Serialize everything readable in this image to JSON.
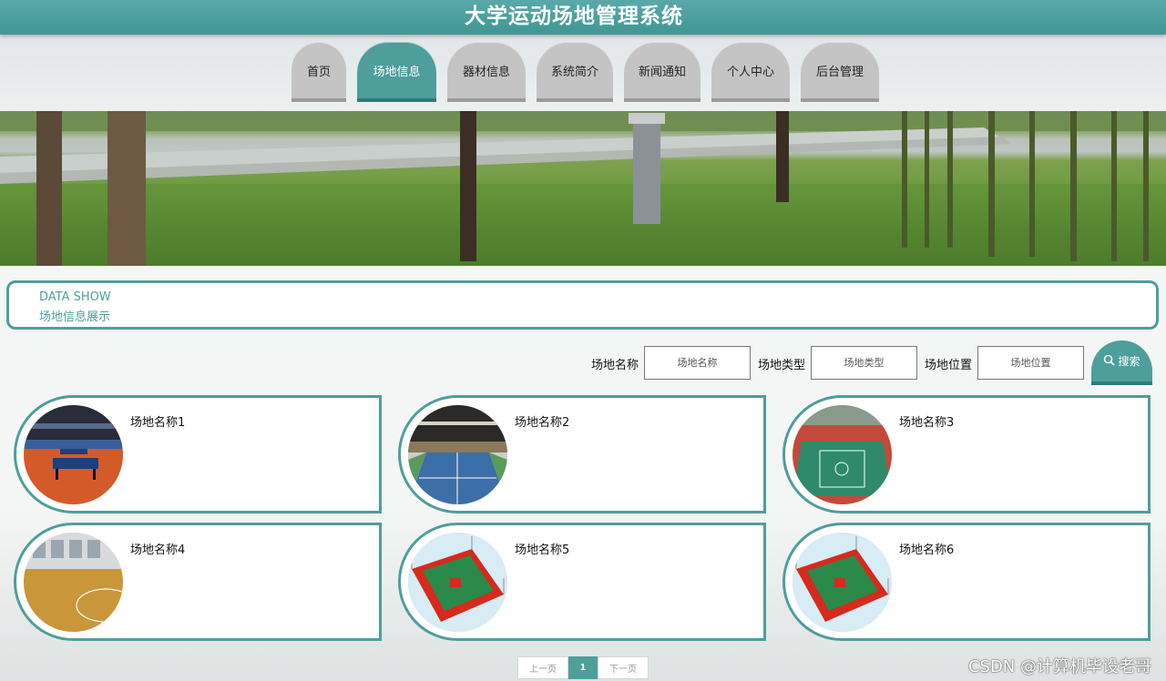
{
  "header": {
    "title": "大学运动场地管理系统"
  },
  "nav": {
    "items": [
      {
        "label": "首页",
        "active": false
      },
      {
        "label": "场地信息",
        "active": true
      },
      {
        "label": "器材信息",
        "active": false
      },
      {
        "label": "系统简介",
        "active": false
      },
      {
        "label": "新闻通知",
        "active": false
      },
      {
        "label": "个人中心",
        "active": false
      },
      {
        "label": "后台管理",
        "active": false
      }
    ]
  },
  "section": {
    "title_en": "DATA SHOW",
    "title_cn": "场地信息展示"
  },
  "search": {
    "name_label": "场地名称",
    "name_placeholder": "场地名称",
    "type_label": "场地类型",
    "type_placeholder": "场地类型",
    "location_label": "场地位置",
    "location_placeholder": "场地位置",
    "button_label": "搜索",
    "button_icon": "search-icon"
  },
  "cards": [
    {
      "name": "场地名称1",
      "image": "table-tennis-hall"
    },
    {
      "name": "场地名称2",
      "image": "badminton-hall"
    },
    {
      "name": "场地名称3",
      "image": "outdoor-court"
    },
    {
      "name": "场地名称4",
      "image": "wooden-basketball-court"
    },
    {
      "name": "场地名称5",
      "image": "red-green-court"
    },
    {
      "name": "场地名称6",
      "image": "red-green-court"
    }
  ],
  "pagination": {
    "prev": "上一页",
    "current": "1",
    "next": "下一页"
  },
  "watermark": "CSDN @计算机毕设老哥",
  "colors": {
    "accent": "#4e9e9b",
    "nav_inactive": "#c4c4c4",
    "header": "#4a9d9b"
  }
}
